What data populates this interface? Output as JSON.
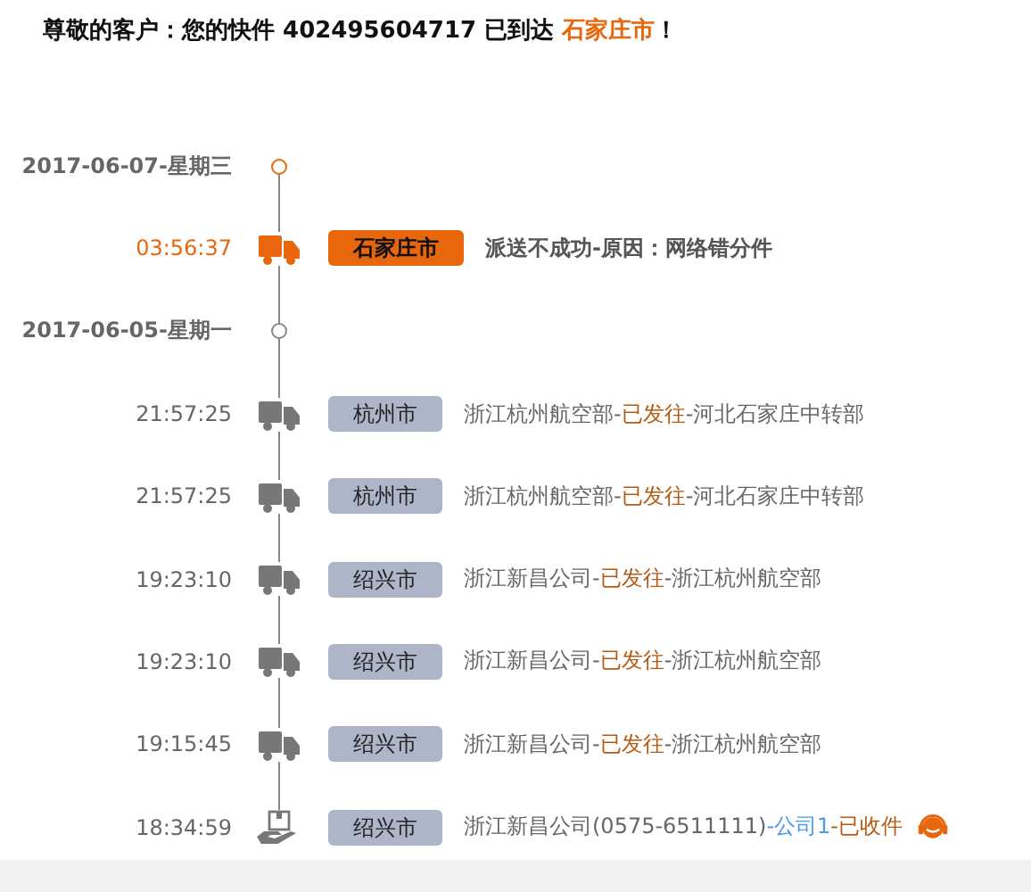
{
  "heading": {
    "text": "尊敬的客户：您的快件 402495604717 已到达",
    "city": "石家庄市",
    "end": "！"
  },
  "days": [
    {
      "date": "2017-06-07-星期三",
      "latest": true,
      "events": [
        {
          "time": "03:56:37",
          "kind": "truck",
          "city": "石家庄市",
          "highlighted": true,
          "description": [
            {
              "kind": "plain",
              "text": "派送不成功-原因：网络错分件"
            }
          ]
        }
      ]
    },
    {
      "date": "2017-06-05-星期一",
      "latest": false,
      "events": [
        {
          "time": "21:57:25",
          "kind": "truck",
          "city": "杭州市",
          "highlighted": false,
          "description": [
            {
              "kind": "plain",
              "text": "浙江杭州航空部-"
            },
            {
              "kind": "status",
              "text": "已发往"
            },
            {
              "kind": "plain",
              "text": "-河北石家庄中转部"
            }
          ]
        },
        {
          "time": "21:57:25",
          "kind": "truck",
          "city": "杭州市",
          "highlighted": false,
          "description": [
            {
              "kind": "plain",
              "text": "浙江杭州航空部-"
            },
            {
              "kind": "status",
              "text": "已发往"
            },
            {
              "kind": "plain",
              "text": "-河北石家庄中转部"
            }
          ]
        },
        {
          "time": "19:23:10",
          "kind": "truck",
          "city": "绍兴市",
          "highlighted": false,
          "description": [
            {
              "kind": "plain",
              "text": "浙江新昌公司-"
            },
            {
              "kind": "status",
              "text": "已发往"
            },
            {
              "kind": "plain",
              "text": "-浙江杭州航空部"
            }
          ]
        },
        {
          "time": "19:23:10",
          "kind": "truck",
          "city": "绍兴市",
          "highlighted": false,
          "description": [
            {
              "kind": "plain",
              "text": "浙江新昌公司-"
            },
            {
              "kind": "status",
              "text": "已发往"
            },
            {
              "kind": "plain",
              "text": "-浙江杭州航空部"
            }
          ]
        },
        {
          "time": "19:15:45",
          "kind": "truck",
          "city": "绍兴市",
          "highlighted": false,
          "description": [
            {
              "kind": "plain",
              "text": "浙江新昌公司-"
            },
            {
              "kind": "status",
              "text": "已发往"
            },
            {
              "kind": "plain",
              "text": "-浙江杭州航空部"
            }
          ]
        },
        {
          "time": "18:34:59",
          "kind": "received",
          "city": "绍兴市",
          "highlighted": false,
          "contact": true,
          "description": [
            {
              "kind": "plain",
              "text": "浙江新昌公司(0575-6511111)"
            },
            {
              "kind": "link",
              "text": "-公司1"
            },
            {
              "kind": "status",
              "text": "-已收件"
            }
          ]
        }
      ]
    }
  ]
}
